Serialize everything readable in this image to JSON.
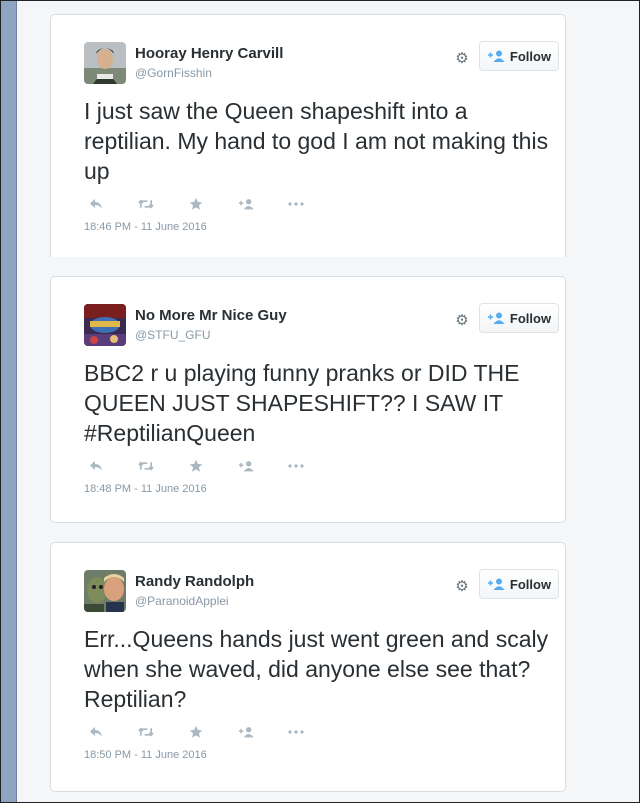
{
  "colors": {
    "sidebar": "#8fa4c0",
    "text": "#292f33",
    "muted": "#8899a6",
    "follow_icon": "#55acee"
  },
  "tweets": [
    {
      "name": "Hooray Henry Carvill",
      "handle": "@GornFisshin",
      "text": "I just saw the Queen shapeshift into a reptilian. My hand to god I am not making this up",
      "timestamp": "18:46 PM - 11 June 2016",
      "follow_label": "Follow"
    },
    {
      "name": "No More Mr Nice Guy",
      "handle": "@STFU_GFU",
      "text": "BBC2 r u playing funny pranks or DID THE QUEEN JUST SHAPESHIFT?? I SAW IT #ReptilianQueen",
      "timestamp": "18:48 PM - 11 June 2016",
      "follow_label": "Follow"
    },
    {
      "name": "Randy Randolph",
      "handle": "@ParanoidApplei",
      "text": "Err...Queens hands just went green and scaly when she waved, did anyone else see that? Reptilian?",
      "timestamp": "18:50 PM - 11 June 2016",
      "follow_label": "Follow"
    }
  ],
  "icons": [
    "reply-icon",
    "retweet-icon",
    "favorite-icon",
    "follow-person-icon",
    "more-icon",
    "gear-icon"
  ]
}
